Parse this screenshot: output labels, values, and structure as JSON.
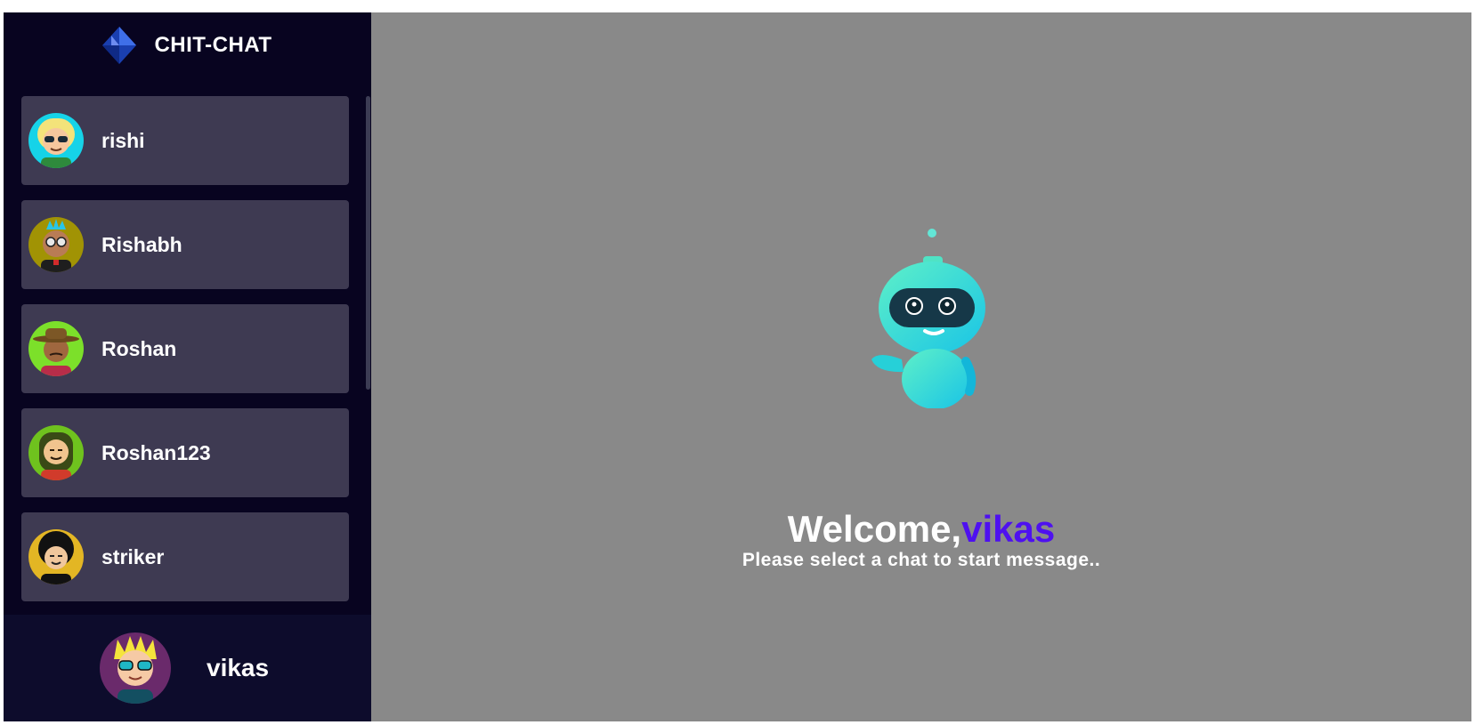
{
  "brand": {
    "title": "CHIT-CHAT",
    "logo_icon": "diamond-logo-icon"
  },
  "contacts": [
    {
      "name": "rishi",
      "avatar": "avatar-blonde-sunglasses"
    },
    {
      "name": "Rishabh",
      "avatar": "avatar-blue-hair-glasses"
    },
    {
      "name": "Roshan",
      "avatar": "avatar-brown-hat"
    },
    {
      "name": "Roshan123",
      "avatar": "avatar-dreadlocks"
    },
    {
      "name": "striker",
      "avatar": "avatar-curly-black-hair"
    }
  ],
  "current_user": {
    "name": "vikas",
    "avatar": "avatar-spiky-yellow-sunglasses"
  },
  "welcome": {
    "greeting": "Welcome,",
    "username": "vikas",
    "hint": "Please select a chat to start message.."
  },
  "colors": {
    "sidebar_bg": "#080420",
    "contact_bg": "#3e3a52",
    "main_bg": "#898989",
    "accent": "#4e10f0"
  }
}
